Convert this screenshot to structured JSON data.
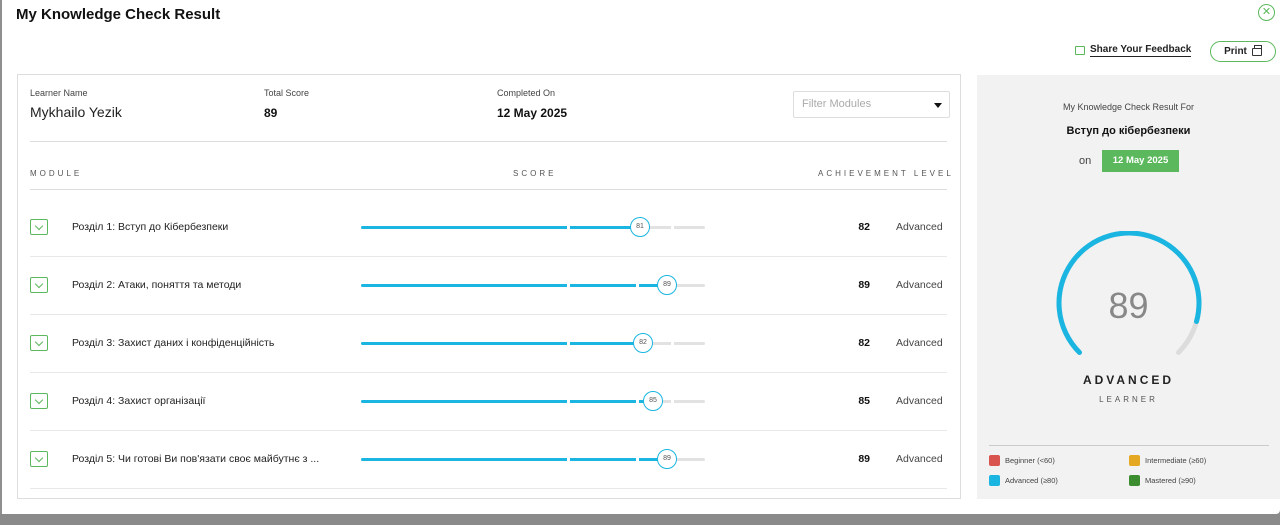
{
  "title": "My Knowledge Check Result",
  "header": {
    "feedback_label": "Share Your Feedback",
    "print_label": "Print"
  },
  "info": {
    "learner_label": "Learner Name",
    "learner_name": "Mykhailo Yezik",
    "score_label": "Total Score",
    "total_score": "89",
    "completed_label": "Completed On",
    "completed_date": "12 May 2025",
    "filter_placeholder": "Filter Modules"
  },
  "columns": {
    "module": "MODULE",
    "score": "SCORE",
    "achievement": "ACHIEVEMENT LEVEL"
  },
  "modules": [
    {
      "name": "Розділ 1: Вступ до Кібербезпеки",
      "marker": "81",
      "score": "82",
      "level": "Advanced",
      "progress": 0.81
    },
    {
      "name": "Розділ 2: Атаки, поняття та методи",
      "marker": "89",
      "score": "89",
      "level": "Advanced",
      "progress": 0.89
    },
    {
      "name": "Розділ 3: Захист даних і конфіденційність",
      "marker": "82",
      "score": "82",
      "level": "Advanced",
      "progress": 0.82
    },
    {
      "name": "Розділ 4: Захист організації",
      "marker": "85",
      "score": "85",
      "level": "Advanced",
      "progress": 0.85
    },
    {
      "name": "Розділ 5: Чи готові Ви пов'язати своє майбутнє з ...",
      "marker": "89",
      "score": "89",
      "level": "Advanced",
      "progress": 0.89
    }
  ],
  "summary": {
    "title": "My Knowledge Check Result For",
    "course": "Вступ до кібербезпеки",
    "on_label": "on",
    "date": "12 May 2025",
    "score": "89",
    "score_fraction": 0.89,
    "level": "ADVANCED",
    "sub": "LEARNER"
  },
  "legend": [
    {
      "label": "Beginner (<60)",
      "color": "#d9534f"
    },
    {
      "label": "Intermediate (≥60)",
      "color": "#e5a823"
    },
    {
      "label": "Advanced (≥80)",
      "color": "#1ab6e1"
    },
    {
      "label": "Mastered (≥90)",
      "color": "#3c8d2f"
    }
  ],
  "colors": {
    "accent": "#5cb85c",
    "bar": "#1ab6e1"
  }
}
